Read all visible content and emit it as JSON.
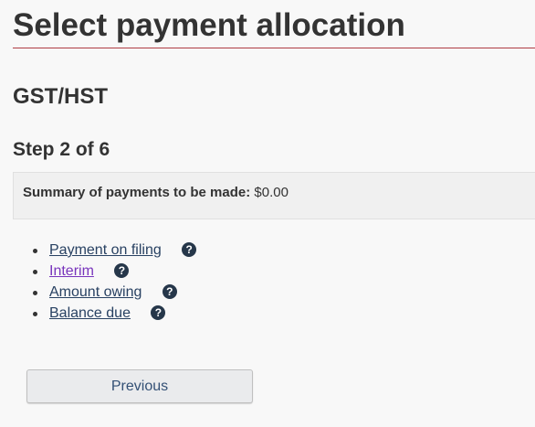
{
  "page": {
    "title": "Select payment allocation",
    "section": "GST/HST",
    "step": "Step 2 of 6"
  },
  "summary": {
    "label": "Summary of payments to be made:",
    "amount": "$0.00"
  },
  "allocations": [
    {
      "label": "Payment on filing",
      "visited": false,
      "help_icon": "question-circle-icon"
    },
    {
      "label": "Interim",
      "visited": true,
      "help_icon": "question-circle-icon"
    },
    {
      "label": "Amount owing",
      "visited": false,
      "help_icon": "question-circle-icon"
    },
    {
      "label": "Balance due",
      "visited": false,
      "help_icon": "question-circle-icon"
    }
  ],
  "help_glyph": "?",
  "buttons": {
    "previous": "Previous"
  },
  "colors": {
    "title_rule": "#af3c43",
    "link": "#284162",
    "visited_link": "#7834bc",
    "help_icon_bg": "#26374a"
  }
}
